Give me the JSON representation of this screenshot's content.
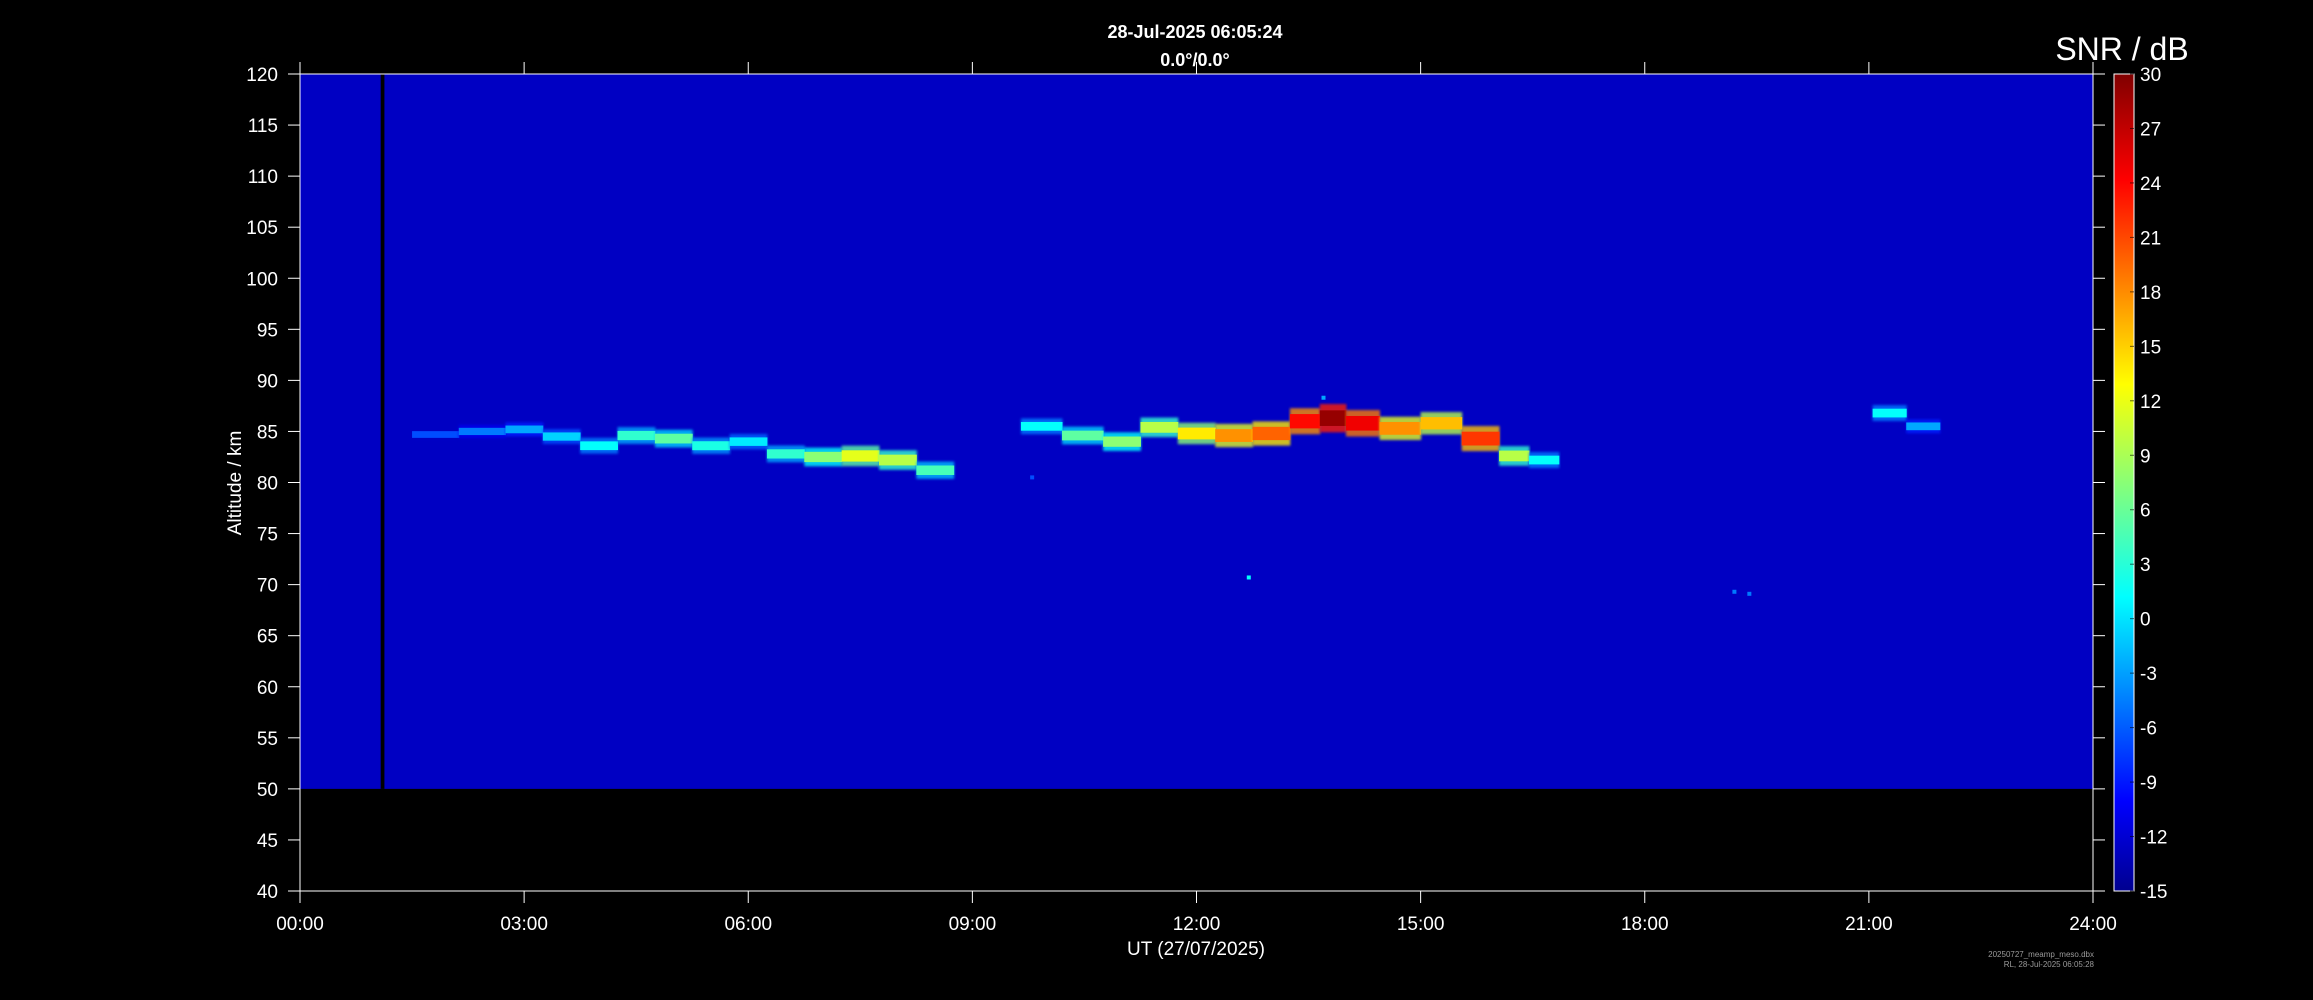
{
  "chart_data": {
    "type": "heatmap",
    "title": "28-Jul-2025 06:05:24",
    "subtitle": "0.0°/0.0°",
    "xlabel": "UT (27/07/2025)",
    "ylabel": "Altitude / km",
    "colorbar_label": "SNR / dB",
    "colormap": "jet",
    "xlim_hours": [
      0,
      24
    ],
    "x_ticks": [
      {
        "hour": 0,
        "label": "00:00"
      },
      {
        "hour": 3,
        "label": "03:00"
      },
      {
        "hour": 6,
        "label": "06:00"
      },
      {
        "hour": 9,
        "label": "09:00"
      },
      {
        "hour": 12,
        "label": "12:00"
      },
      {
        "hour": 15,
        "label": "15:00"
      },
      {
        "hour": 18,
        "label": "18:00"
      },
      {
        "hour": 21,
        "label": "21:00"
      },
      {
        "hour": 24,
        "label": "24:00"
      }
    ],
    "ylim": [
      40,
      120
    ],
    "y_ticks": [
      40,
      45,
      50,
      55,
      60,
      65,
      70,
      75,
      80,
      85,
      90,
      95,
      100,
      105,
      110,
      115,
      120
    ],
    "clim": [
      -15,
      30
    ],
    "colorbar_ticks": [
      -15,
      -12,
      -9,
      -6,
      -3,
      0,
      3,
      6,
      9,
      12,
      15,
      18,
      21,
      24,
      27,
      30
    ],
    "data_altitude_range_km": [
      50,
      120
    ],
    "background_snr_db": -12,
    "data_gap": {
      "start_hour": 1.08,
      "end_hour": 1.13
    },
    "echo_layer": [
      {
        "t": 1.75,
        "alt": 84.7,
        "snr": -6
      },
      {
        "t": 2.5,
        "alt": 85.0,
        "snr": -4
      },
      {
        "t": 3.0,
        "alt": 85.2,
        "snr": -2
      },
      {
        "t": 3.5,
        "alt": 84.5,
        "snr": 0
      },
      {
        "t": 4.0,
        "alt": 83.6,
        "snr": 2
      },
      {
        "t": 4.5,
        "alt": 84.6,
        "snr": 4
      },
      {
        "t": 5.0,
        "alt": 84.3,
        "snr": 6
      },
      {
        "t": 5.5,
        "alt": 83.6,
        "snr": 3
      },
      {
        "t": 6.0,
        "alt": 84.0,
        "snr": 1
      },
      {
        "t": 6.5,
        "alt": 82.8,
        "snr": 4
      },
      {
        "t": 7.0,
        "alt": 82.5,
        "snr": 8
      },
      {
        "t": 7.5,
        "alt": 82.6,
        "snr": 12
      },
      {
        "t": 8.0,
        "alt": 82.2,
        "snr": 10
      },
      {
        "t": 8.5,
        "alt": 81.2,
        "snr": 5
      },
      {
        "t": 9.9,
        "alt": 85.5,
        "snr": 2
      },
      {
        "t": 10.5,
        "alt": 84.6,
        "snr": 6
      },
      {
        "t": 11.0,
        "alt": 84.0,
        "snr": 8
      },
      {
        "t": 11.5,
        "alt": 85.4,
        "snr": 10
      },
      {
        "t": 12.0,
        "alt": 84.8,
        "snr": 14
      },
      {
        "t": 12.5,
        "alt": 84.6,
        "snr": 18
      },
      {
        "t": 13.0,
        "alt": 84.8,
        "snr": 20
      },
      {
        "t": 13.5,
        "alt": 86.0,
        "snr": 24
      },
      {
        "t": 13.8,
        "alt": 86.3,
        "snr": 29
      },
      {
        "t": 14.2,
        "alt": 85.8,
        "snr": 25
      },
      {
        "t": 14.7,
        "alt": 85.3,
        "snr": 18
      },
      {
        "t": 15.3,
        "alt": 85.8,
        "snr": 16
      },
      {
        "t": 15.8,
        "alt": 84.3,
        "snr": 22
      },
      {
        "t": 16.3,
        "alt": 82.6,
        "snr": 10
      },
      {
        "t": 16.6,
        "alt": 82.2,
        "snr": 2
      },
      {
        "t": 21.3,
        "alt": 86.8,
        "snr": 2
      },
      {
        "t": 21.7,
        "alt": 85.5,
        "snr": -2
      }
    ],
    "isolated_echoes": [
      {
        "t": 12.7,
        "alt": 70.7,
        "snr": 2
      },
      {
        "t": 19.2,
        "alt": 69.3,
        "snr": -4
      },
      {
        "t": 19.4,
        "alt": 69.1,
        "snr": -4
      },
      {
        "t": 13.7,
        "alt": 88.3,
        "snr": -2
      },
      {
        "t": 9.8,
        "alt": 80.5,
        "snr": -6
      }
    ],
    "colors": {
      "background": "#000000",
      "text": "#ffffff",
      "axis": "#ffffff",
      "no_data": "#000000"
    }
  },
  "footer": {
    "line1": "20250727_meamp_meso.dbx",
    "line2": "RL, 28-Jul-2025 06:05:28"
  }
}
